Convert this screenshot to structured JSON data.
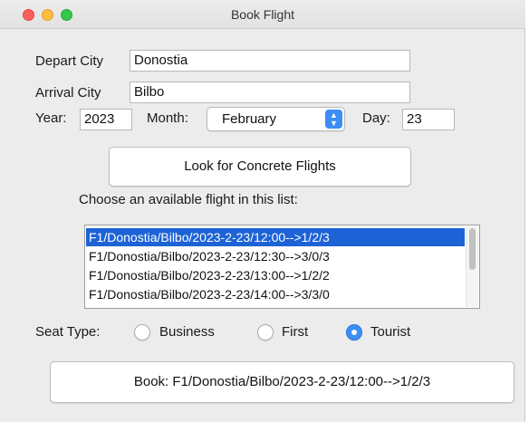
{
  "window": {
    "title": "Book Flight"
  },
  "form": {
    "depart_label": "Depart City",
    "depart_value": "Donostia",
    "arrival_label": "Arrival City",
    "arrival_value": "Bilbo",
    "year_label": "Year:",
    "year_value": "2023",
    "month_label": "Month:",
    "month_value": "February",
    "day_label": "Day:",
    "day_value": "23"
  },
  "search_button": {
    "label": "Look for Concrete Flights"
  },
  "flights": {
    "prompt": "Choose an available flight in this list:",
    "items": [
      "F1/Donostia/Bilbo/2023-2-23/12:00-->1/2/3",
      "F1/Donostia/Bilbo/2023-2-23/12:30-->3/0/3",
      "F1/Donostia/Bilbo/2023-2-23/13:00-->1/2/2",
      "F1/Donostia/Bilbo/2023-2-23/14:00-->3/3/0"
    ],
    "selected_index": 0
  },
  "seat": {
    "label": "Seat Type:",
    "options": [
      "Business",
      "First",
      "Tourist"
    ],
    "selected": "Tourist"
  },
  "book_button": {
    "label": "Book: F1/Donostia/Bilbo/2023-2-23/12:00-->1/2/3"
  },
  "colors": {
    "accent": "#3b8ef3",
    "selection": "#1d63d6",
    "close": "#fc605c",
    "minimize": "#fdbc40",
    "maximize": "#34c84a"
  },
  "icons": {
    "close": "close-icon",
    "minimize": "minimize-icon",
    "maximize": "maximize-icon",
    "select_arrow": "up-down-chevron-icon"
  }
}
